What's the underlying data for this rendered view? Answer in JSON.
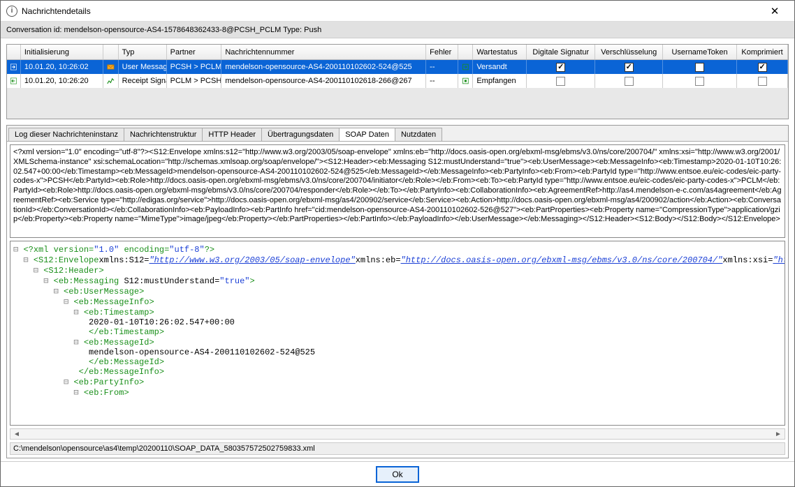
{
  "window": {
    "title": "Nachrichtendetails",
    "icon_letter": "i"
  },
  "conversation_bar": "Conversation id: mendelson-opensource-AS4-1578648362433-8@PCSH_PCLM Type: Push",
  "grid": {
    "headers": {
      "init": "Initialisierung",
      "typ": "Typ",
      "partner": "Partner",
      "msg": "Nachrichtennummer",
      "fehler": "Fehler",
      "wstatus": "Wartestatus",
      "sig": "Digitale Signatur",
      "enc": "Verschlüsselung",
      "utok": "UsernameToken",
      "komp": "Komprimiert"
    },
    "rows": [
      {
        "dir": "out",
        "init": "10.01.20, 10:26:02",
        "typ_icon": "env",
        "typ": "User Message",
        "partner": "PCSH > PCLM",
        "msg": "mendelson-opensource-AS4-200110102602-524@525",
        "fehler": "--",
        "ws_icon": "sent",
        "wstatus": "Versandt",
        "sig": true,
        "enc": true,
        "utok": false,
        "komp": true,
        "selected": true
      },
      {
        "dir": "in",
        "init": "10.01.20, 10:26:20",
        "typ_icon": "chart",
        "typ": "Receipt Signal",
        "partner": "PCLM > PCSH",
        "msg": "mendelson-opensource-AS4-200110102618-266@267",
        "fehler": "--",
        "ws_icon": "recv",
        "wstatus": "Empfangen",
        "sig": false,
        "enc": false,
        "utok": false,
        "komp": false,
        "selected": false
      }
    ]
  },
  "tabs": {
    "items": [
      "Log dieser Nachrichteninstanz",
      "Nachrichtenstruktur",
      "HTTP Header",
      "Übertragungsdaten",
      "SOAP Daten",
      "Nutzdaten"
    ],
    "active_index": 4
  },
  "soap_raw": "<?xml version=\"1.0\" encoding=\"utf-8\"?><S12:Envelope xmlns:s12=\"http://www.w3.org/2003/05/soap-envelope\" xmlns:eb=\"http://docs.oasis-open.org/ebxml-msg/ebms/v3.0/ns/core/200704/\" xmlns:xsi=\"http://www.w3.org/2001/XMLSchema-instance\" xsi:schemaLocation=\"http://schemas.xmlsoap.org/soap/envelope/\"><S12:Header><eb:Messaging S12:mustUnderstand=\"true\"><eb:UserMessage><eb:MessageInfo><eb:Timestamp>2020-01-10T10:26:02.547+00:00</eb:Timestamp><eb:MessageId>mendelson-opensource-AS4-200110102602-524@525</eb:MessageId></eb:MessageInfo><eb:PartyInfo><eb:From><eb:PartyId type=\"http://www.entsoe.eu/eic-codes/eic-party-codes-x\">PCSH</eb:PartyId><eb:Role>http://docs.oasis-open.org/ebxml-msg/ebms/v3.0/ns/core/200704/initiator</eb:Role></eb:From><eb:To><eb:PartyId type=\"http://www.entsoe.eu/eic-codes/eic-party-codes-x\">PCLM</eb:PartyId><eb:Role>http://docs.oasis-open.org/ebxml-msg/ebms/v3.0/ns/core/200704/responder</eb:Role></eb:To></eb:PartyInfo><eb:CollaborationInfo><eb:AgreementRef>http://as4.mendelson-e-c.com/as4agreement</eb:AgreementRef><eb:Service type=\"http://edigas.org/service\">http://docs.oasis-open.org/ebxml-msg/as4/200902/service</eb:Service><eb:Action>http://docs.oasis-open.org/ebxml-msg/as4/200902/action</eb:Action><eb:ConversationId></eb:ConversationId></eb:CollaborationInfo><eb:PayloadInfo><eb:PartInfo href=\"cid:mendelson-opensource-AS4-200110102602-526@527\"><eb:PartProperties><eb:Property name=\"CompressionType\">application/gzip</eb:Property><eb:Property name=\"MimeType\">image/jpeg</eb:Property></eb:PartProperties></eb:PartInfo></eb:PayloadInfo></eb:UserMessage></eb:Messaging></S12:Header><S12:Body></S12:Body></S12:Envelope>",
  "tree": {
    "line0_a": "<?xml version=",
    "line0_b": "\"1.0\"",
    "line0_c": " encoding=",
    "line0_d": "\"utf-8\"",
    "line0_e": "?>",
    "l1_a": "<S12:Envelope",
    "l1_b": "xmlns:S12=",
    "l1_c": "\"http://www.w3.org/2003/05/soap-envelope\"",
    "l1_d": "xmlns:eb=",
    "l1_e": "\"http://docs.oasis-open.org/ebxml-msg/ebms/v3.0/ns/core/200704/\"",
    "l1_f": "xmlns:xsi=",
    "l1_g": "\"http:",
    "l2": "<S12:Header>",
    "l3_a": "<eb:Messaging",
    "l3_b": " S12:mustUnderstand=",
    "l3_c": "\"true\"",
    "l3_d": ">",
    "l4": "<eb:UserMessage>",
    "l5": "<eb:MessageInfo>",
    "l6": "<eb:Timestamp>",
    "l7": "2020-01-10T10:26:02.547+00:00",
    "l8": "</eb:Timestamp>",
    "l9": "<eb:MessageId>",
    "l10": "mendelson-opensource-AS4-200110102602-524@525",
    "l11": "</eb:MessageId>",
    "l12": "</eb:MessageInfo>",
    "l13": "<eb:PartyInfo>",
    "l14": "<eb:From>"
  },
  "file_path": "C:\\mendelson\\opensource\\as4\\temp\\20200110\\SOAP_DATA_580357572502759833.xml",
  "footer": {
    "ok": "Ok"
  }
}
